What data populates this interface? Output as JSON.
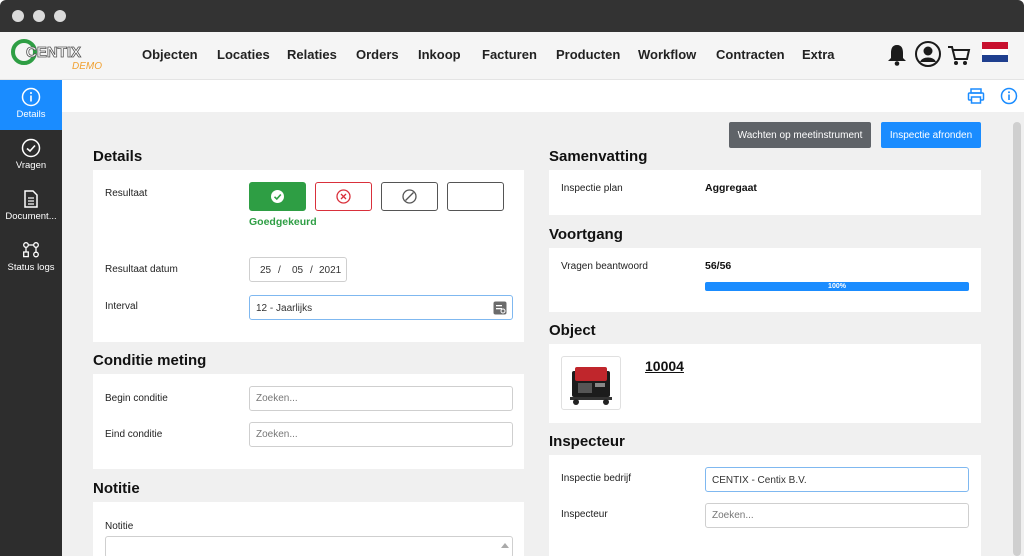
{
  "app": {
    "logo_text": "CENTIX",
    "logo_sub": "DEMO"
  },
  "nav": {
    "items": [
      "Objecten",
      "Locaties",
      "Relaties",
      "Orders",
      "Inkoop",
      "Facturen",
      "Producten",
      "Workflow",
      "Contracten",
      "Extra"
    ],
    "icons": [
      "bell-icon",
      "user-icon",
      "cart-icon",
      "flag-nl-icon"
    ]
  },
  "sidebar": {
    "items": [
      {
        "label": "Details",
        "icon": "info-icon",
        "active": true
      },
      {
        "label": "Vragen",
        "icon": "check-circle-icon",
        "active": false
      },
      {
        "label": "Document...",
        "icon": "document-icon",
        "active": false
      },
      {
        "label": "Status logs",
        "icon": "status-flow-icon",
        "active": false
      }
    ]
  },
  "actions": {
    "wait_label": "Wachten op meetinstrument",
    "finish_label": "Inspectie afronden"
  },
  "details": {
    "title": "Details",
    "result_label": "Resultaat",
    "result_status": "Goedgekeurd",
    "result_date_label": "Resultaat datum",
    "date_day": "25",
    "date_month": "05",
    "date_year": "2021",
    "date_sep": "/",
    "interval_label": "Interval",
    "interval_value": "12 - Jaarlijks"
  },
  "condition": {
    "title": "Conditie meting",
    "begin_label": "Begin conditie",
    "end_label": "Eind conditie",
    "placeholder": "Zoeken..."
  },
  "notes": {
    "title": "Notitie",
    "label": "Notitie"
  },
  "summary": {
    "title": "Samenvatting",
    "plan_label": "Inspectie plan",
    "plan_value": "Aggregaat"
  },
  "progress": {
    "title": "Voortgang",
    "answered_label": "Vragen beantwoord",
    "answered_value": "56/56",
    "percent_text": "100%",
    "fraction": 1.0
  },
  "object": {
    "title": "Object",
    "number": "10004"
  },
  "inspector": {
    "title": "Inspecteur",
    "company_label": "Inspectie bedrijf",
    "company_value": "CENTIX - Centix B.V.",
    "inspector_label": "Inspecteur",
    "placeholder": "Zoeken..."
  },
  "colors": {
    "accent": "#1a8cff",
    "success": "#2e9e44",
    "danger": "#d9303b",
    "sidebar": "#2d2d2d"
  }
}
